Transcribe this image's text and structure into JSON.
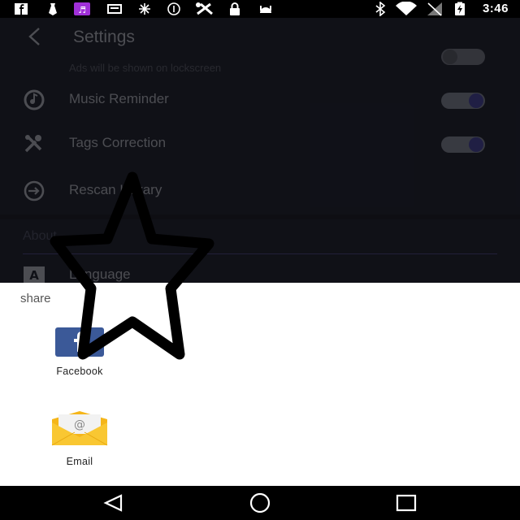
{
  "status_bar": {
    "time": "3:46",
    "icons": [
      "facebook-icon",
      "tie-icon",
      "music-app-icon",
      "tablet-icon",
      "fan-icon",
      "info-icon",
      "fast-tools-icon",
      "lock-icon",
      "android-icon",
      "bluetooth-icon",
      "wifi-icon",
      "no-signal-icon",
      "battery-charging-icon"
    ]
  },
  "header": {
    "title": "Settings"
  },
  "settings": {
    "lockscreen_subtext": "Ads will be shown on lockscreen",
    "items": [
      {
        "label": "Music Reminder",
        "icon": "music-reminder-icon",
        "toggle": true
      },
      {
        "label": "Tags Correction",
        "icon": "tools-icon",
        "toggle": true
      },
      {
        "label": "Rescan Library",
        "icon": "rescan-icon"
      }
    ],
    "section_title": "About",
    "language_label": "Language"
  },
  "share_sheet": {
    "title": "share",
    "apps": [
      {
        "label": "Facebook",
        "icon": "facebook-app-icon"
      },
      {
        "label": "Email",
        "icon": "email-app-icon"
      }
    ]
  },
  "colors": {
    "background": "#1e1f2b",
    "toggle_knob": "#3b3a7d",
    "facebook_blue": "#3b5998",
    "email_yellow": "#f9c732"
  }
}
